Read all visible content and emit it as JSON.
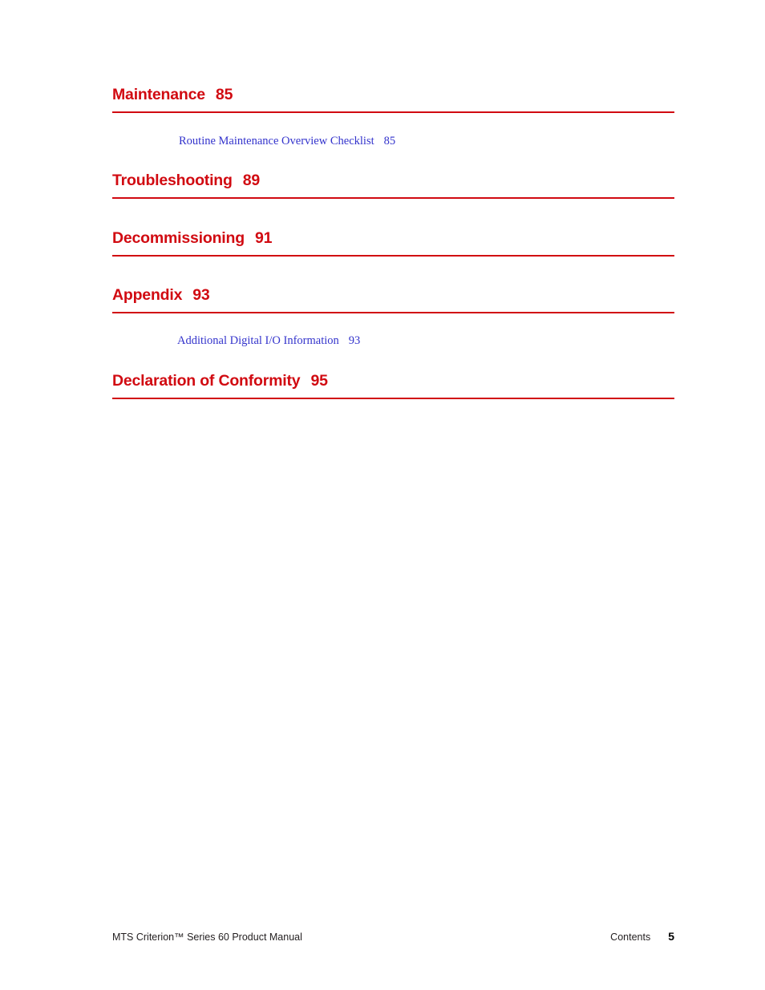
{
  "document": {
    "page_background": "#ffffff",
    "heading_color": "#d10a11",
    "subentry_color": "#3333cc",
    "rule_color": "#d10a11",
    "footer_color": "#231f20"
  },
  "toc": {
    "entries": [
      {
        "title": "Maintenance",
        "page": "85",
        "subentries": [
          {
            "title": "Routine Maintenance Overview Checklist",
            "page": "85"
          }
        ]
      },
      {
        "title": "Troubleshooting",
        "page": "89",
        "subentries": []
      },
      {
        "title": "Decommissioning",
        "page": "91",
        "subentries": []
      },
      {
        "title": "Appendix",
        "page": "93",
        "subentries": [
          {
            "title": "Additional Digital I/O Information",
            "page": "93"
          }
        ]
      },
      {
        "title": "Declaration of Conformity",
        "page": "95",
        "subentries": []
      }
    ]
  },
  "footer": {
    "manual_title": "MTS Criterion™ Series 60 Product Manual",
    "section_label": "Contents",
    "page_number": "5"
  }
}
